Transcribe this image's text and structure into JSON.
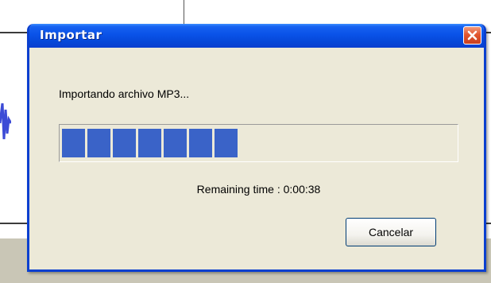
{
  "dialog": {
    "title": "Importar",
    "message": "Importando archivo MP3...",
    "progress_fraction": 0.47,
    "remaining_time": "Remaining time : 0:00:38",
    "cancel_label": "Cancelar"
  },
  "icons": {
    "close": "close-icon"
  },
  "colors": {
    "titlebar": "#0a52e8",
    "progress": "#3a63c8",
    "close_button": "#e2562f",
    "dialog_background": "#ece9d8"
  }
}
